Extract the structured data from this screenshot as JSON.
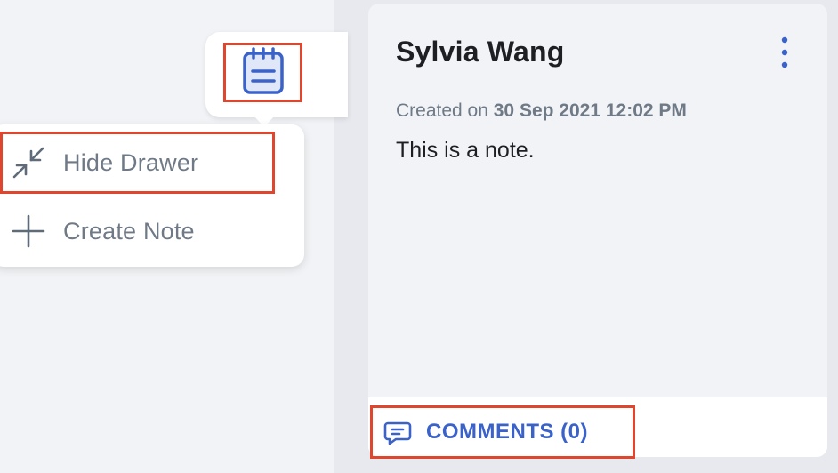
{
  "drawer_menu": {
    "hide_label": "Hide Drawer",
    "create_label": "Create Note"
  },
  "note": {
    "author": "Sylvia Wang",
    "created_prefix": "Created on",
    "created_date": "30 Sep 2021 12:02 PM",
    "body": "This is a note."
  },
  "comments": {
    "label": "COMMENTS (0)"
  },
  "icons": {
    "notes_tab": "notepad-icon",
    "hide": "collapse-arrows-icon",
    "create": "plus-icon",
    "more": "vertical-dots-icon",
    "comments": "comment-bubble-icon"
  },
  "colors": {
    "accent": "#3a62c9",
    "highlight": "#e0452e",
    "muted_text": "#6f7a86"
  }
}
